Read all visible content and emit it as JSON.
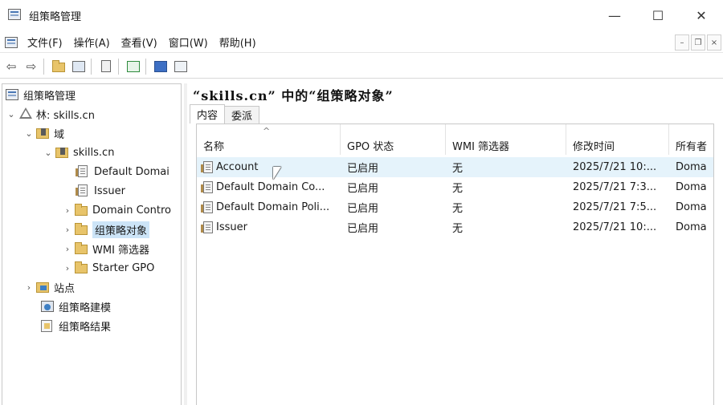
{
  "window": {
    "title": "组策略管理",
    "minimize_glyph": "—",
    "maximize_glyph": "☐",
    "close_glyph": "✕"
  },
  "menu": {
    "items": [
      "文件(F)",
      "操作(A)",
      "查看(V)",
      "窗口(W)",
      "帮助(H)"
    ],
    "mdi_min": "–",
    "mdi_restore": "❐",
    "mdi_close": "×"
  },
  "toolbar": {
    "back_glyph": "⇦",
    "forward_glyph": "⇨",
    "icons": [
      "back-icon",
      "forward-icon",
      "up-folder-icon",
      "show-hide-tree-icon",
      "properties-icon",
      "refresh-icon",
      "help-icon",
      "show-action-pane-icon"
    ]
  },
  "tree": {
    "root": "组策略管理",
    "forest": "林: skills.cn",
    "domains": "域",
    "domain": "skills.cn",
    "gpo_links": [
      "Default Domai",
      "Issuer"
    ],
    "domain_controllers": "Domain Contro",
    "gpo_objects": "组策略对象",
    "wmi_filters": "WMI 筛选器",
    "starter_gpo": "Starter GPO",
    "sites": "站点",
    "modeling": "组策略建模",
    "results": "组策略结果"
  },
  "pane": {
    "title": "“skills.cn” 中的“组策略对象”",
    "tabs": [
      "内容",
      "委派"
    ]
  },
  "table": {
    "columns": [
      "名称",
      "GPO 状态",
      "WMI 筛选器",
      "修改时间",
      "所有者"
    ],
    "sort_arrow": "^",
    "rows": [
      {
        "name": "Account",
        "status": "已启用",
        "wmi": "无",
        "time": "2025/7/21 10:...",
        "owner": "Doma"
      },
      {
        "name": "Default Domain Co...",
        "status": "已启用",
        "wmi": "无",
        "time": "2025/7/21 7:3...",
        "owner": "Doma"
      },
      {
        "name": "Default Domain Poli...",
        "status": "已启用",
        "wmi": "无",
        "time": "2025/7/21 7:5...",
        "owner": "Doma"
      },
      {
        "name": "Issuer",
        "status": "已启用",
        "wmi": "无",
        "time": "2025/7/21 10:...",
        "owner": "Doma"
      }
    ]
  }
}
